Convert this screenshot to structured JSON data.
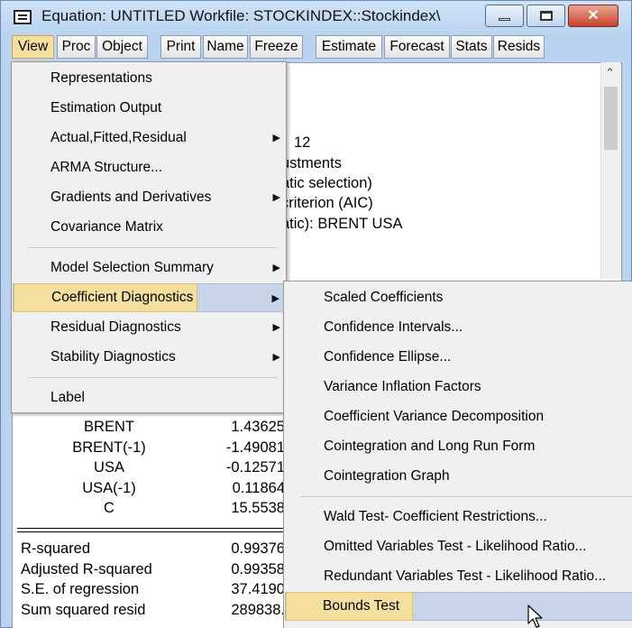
{
  "window": {
    "title": "Equation: UNTITLED   Workfile: STOCKINDEX::Stockindex\\",
    "close_glyph": "✕"
  },
  "toolbar": [
    "View",
    "Proc",
    "Object",
    "Print",
    "Name",
    "Freeze",
    "Estimate",
    "Forecast",
    "Stats",
    "Resids"
  ],
  "background_text": {
    "lines": [
      "12",
      "ustments",
      "atic selection)",
      "criterion (AIC)",
      "atic): BRENT USA"
    ]
  },
  "coef_table": {
    "rows": [
      {
        "var": "BRENT",
        "coef": "1.43625"
      },
      {
        "var": "BRENT(-1)",
        "coef": "-1.49081"
      },
      {
        "var": "USA",
        "coef": "-0.12571"
      },
      {
        "var": "USA(-1)",
        "coef": "0.11864"
      },
      {
        "var": "C",
        "coef": "15.5538"
      }
    ]
  },
  "stats_table": {
    "rows": [
      {
        "label": "R-squared",
        "value": "0.99376"
      },
      {
        "label": "Adjusted R-squared",
        "value": "0.99358"
      },
      {
        "label": "S.E. of regression",
        "value": "37.4190"
      },
      {
        "label": "Sum squared resid",
        "value": "289838."
      }
    ]
  },
  "view_menu": {
    "items": [
      {
        "label": "Representations",
        "submenu": false
      },
      {
        "label": "Estimation Output",
        "submenu": false
      },
      {
        "label": "Actual,Fitted,Residual",
        "submenu": true
      },
      {
        "label": "ARMA Structure...",
        "submenu": false
      },
      {
        "label": "Gradients and Derivatives",
        "submenu": true
      },
      {
        "label": "Covariance Matrix",
        "submenu": false
      },
      {
        "label": "Model Selection Summary",
        "submenu": true
      },
      {
        "label": "Coefficient Diagnostics",
        "submenu": true,
        "highlighted": true
      },
      {
        "label": "Residual Diagnostics",
        "submenu": true
      },
      {
        "label": "Stability Diagnostics",
        "submenu": true
      },
      {
        "label": "Label",
        "submenu": false
      }
    ]
  },
  "coef_diag_menu": {
    "items": [
      {
        "label": "Scaled Coefficients"
      },
      {
        "label": "Confidence Intervals..."
      },
      {
        "label": "Confidence Ellipse..."
      },
      {
        "label": "Variance Inflation Factors"
      },
      {
        "label": "Coefficient Variance Decomposition"
      },
      {
        "label": "Cointegration and Long Run Form"
      },
      {
        "label": "Cointegration Graph"
      },
      {
        "label": "Wald Test- Coefficient Restrictions..."
      },
      {
        "label": "Omitted Variables Test - Likelihood Ratio..."
      },
      {
        "label": "Redundant Variables Test - Likelihood Ratio..."
      },
      {
        "label": "Bounds Test",
        "highlighted": true
      }
    ]
  },
  "submenu_arrow": "▶",
  "colors": {
    "highlight": "#f5df9e",
    "highlight_border": "#e0c16c",
    "close_button": "#c7442b"
  }
}
